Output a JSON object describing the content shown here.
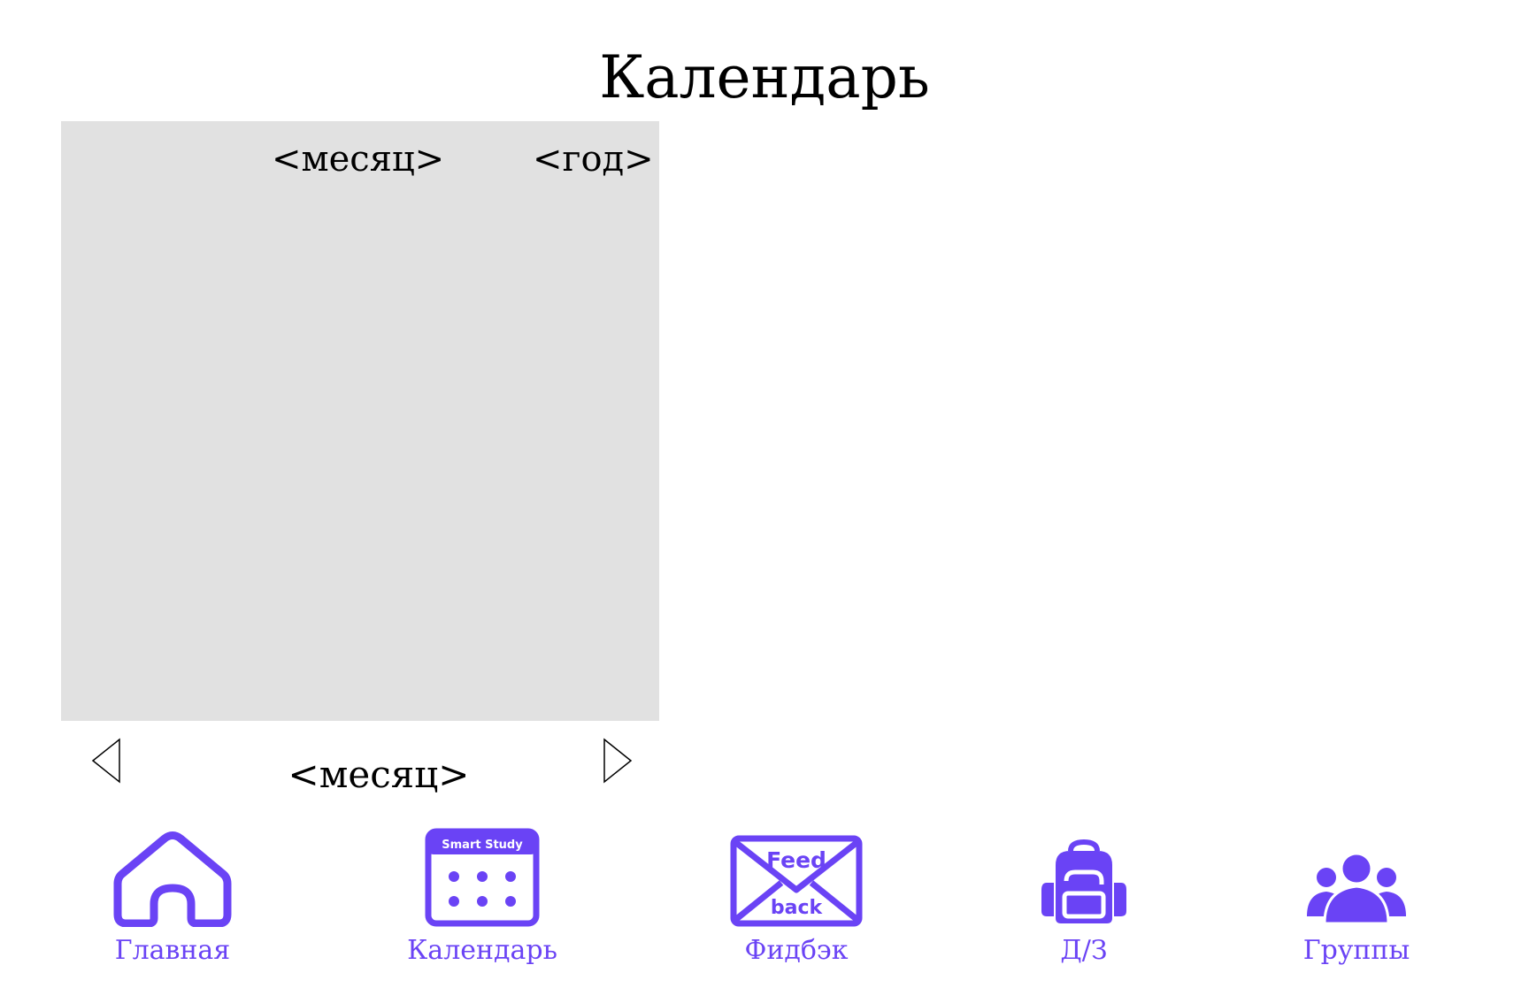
{
  "page": {
    "title": "Календарь"
  },
  "calendar": {
    "month_placeholder": "<месяц>",
    "year_placeholder": "<год>",
    "bottom_month_placeholder": "<месяц>",
    "prev_icon": "triangle-left-outline",
    "next_icon": "triangle-right-outline"
  },
  "nav": {
    "accent_color": "#6a43f5",
    "items": [
      {
        "label": "Главная",
        "icon": "home-icon"
      },
      {
        "label": "Календарь",
        "icon": "calendar-icon",
        "icon_text": "Smart Study"
      },
      {
        "label": "Фидбэк",
        "icon": "envelope-icon",
        "icon_text_top": "Feed",
        "icon_text_bottom": "back"
      },
      {
        "label": "Д/З",
        "icon": "backpack-icon"
      },
      {
        "label": "Группы",
        "icon": "group-icon"
      }
    ]
  }
}
